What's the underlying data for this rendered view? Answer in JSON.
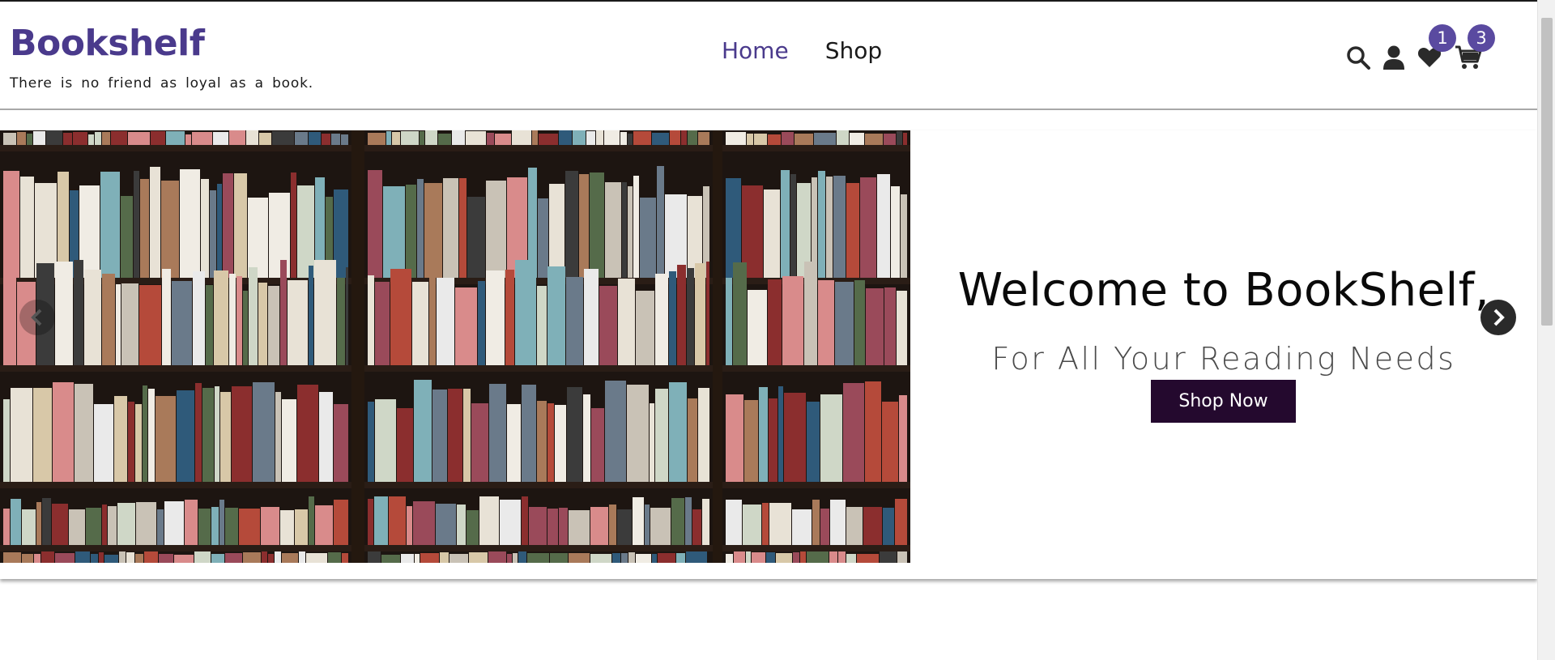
{
  "header": {
    "brand": "Bookshelf",
    "tagline": "There is no friend as loyal as a book.",
    "nav": [
      {
        "label": "Home",
        "active": true
      },
      {
        "label": "Shop",
        "active": false
      }
    ],
    "icons": {
      "search": "search-icon",
      "user": "user-icon",
      "wishlist": "heart-icon",
      "cart": "cart-icon"
    },
    "wishlist_count": "1",
    "cart_count": "3"
  },
  "hero": {
    "image": "bookshelf-photo",
    "title": "Welcome to BookShelf,",
    "subtitle": "For All Your Reading Needs",
    "cta_label": "Shop Now",
    "prev_icon": "chevron-left-icon",
    "next_icon": "chevron-right-icon"
  },
  "colors": {
    "brand": "#4a3a8c",
    "button": "#24092e",
    "badge": "#5a4aa0"
  }
}
